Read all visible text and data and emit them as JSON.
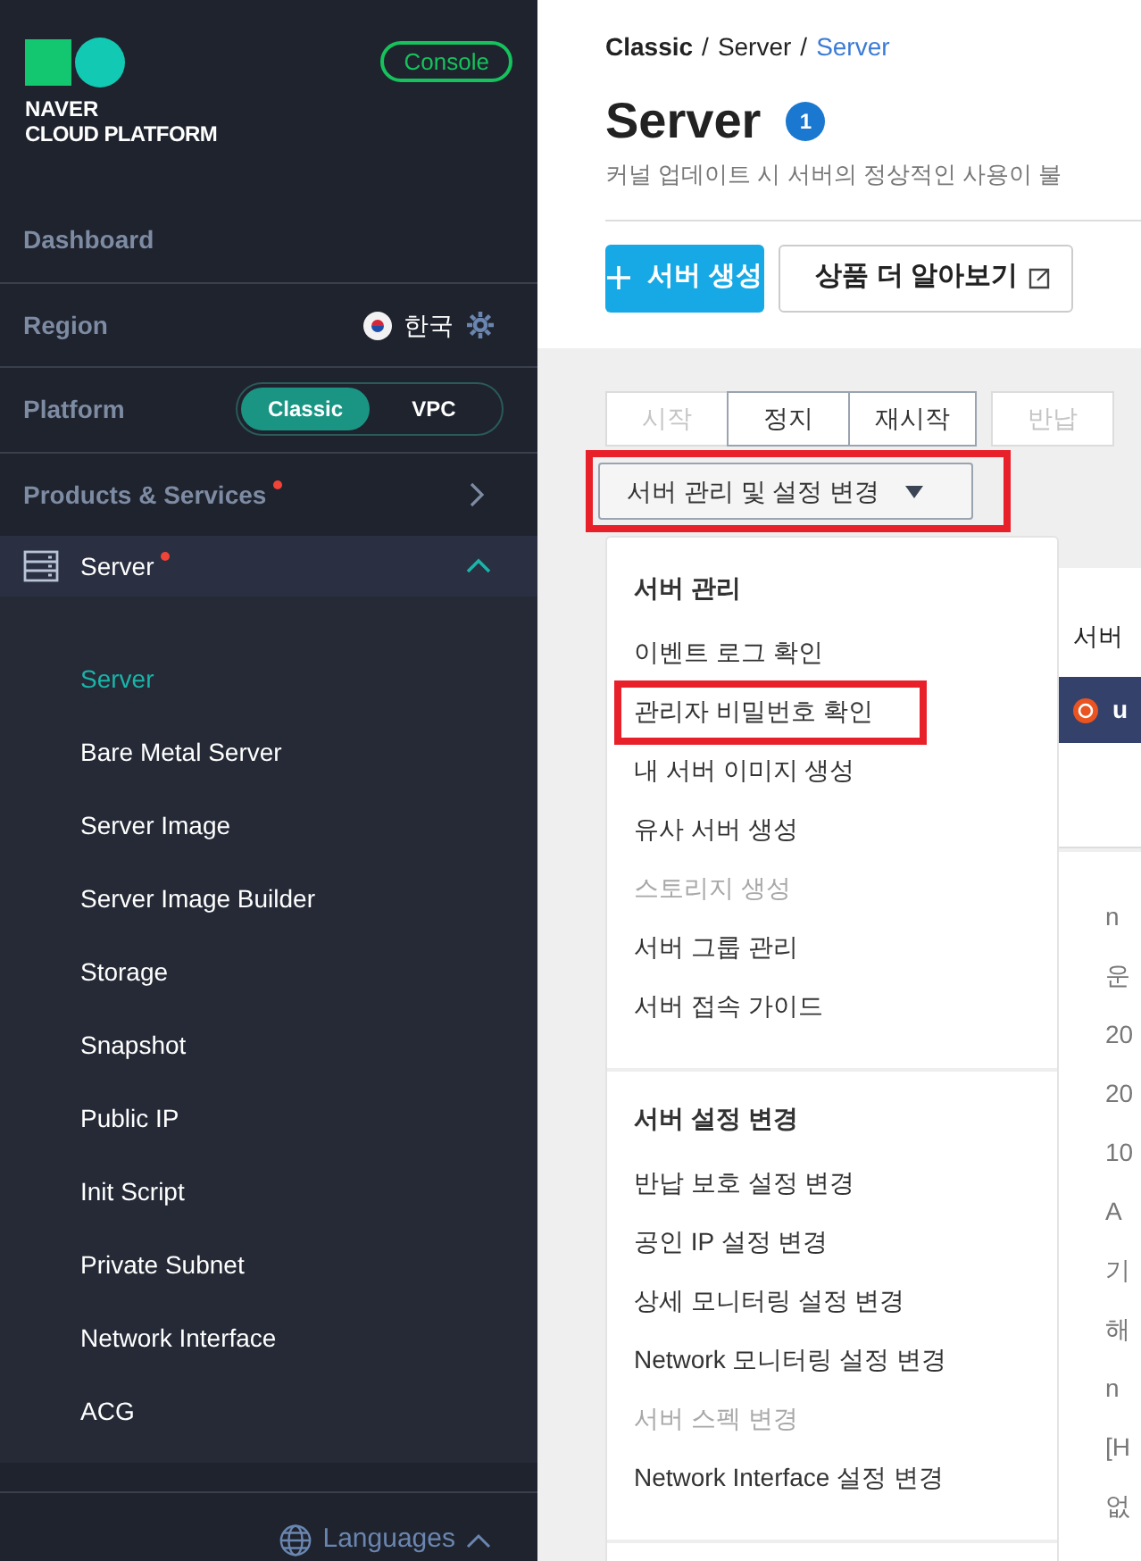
{
  "sidebar": {
    "brand": {
      "line1": "NAVER",
      "line2": "CLOUD PLATFORM"
    },
    "console_button": "Console",
    "dashboard": "Dashboard",
    "region": {
      "label": "Region",
      "value": "한국"
    },
    "platform": {
      "label": "Platform",
      "options": [
        {
          "label": "Classic",
          "selected": true
        },
        {
          "label": "VPC",
          "selected": false
        }
      ]
    },
    "products": {
      "label": "Products & Services",
      "new": true
    },
    "section": {
      "label": "Server",
      "new": true,
      "expanded": true,
      "items": [
        {
          "label": "Server",
          "selected": true
        },
        {
          "label": "Bare Metal Server",
          "selected": false
        },
        {
          "label": "Server Image",
          "selected": false
        },
        {
          "label": "Server Image Builder",
          "selected": false
        },
        {
          "label": "Storage",
          "selected": false
        },
        {
          "label": "Snapshot",
          "selected": false
        },
        {
          "label": "Public IP",
          "selected": false
        },
        {
          "label": "Init Script",
          "selected": false
        },
        {
          "label": "Private Subnet",
          "selected": false
        },
        {
          "label": "Network Interface",
          "selected": false
        },
        {
          "label": "ACG",
          "selected": false
        }
      ]
    },
    "languages": "Languages"
  },
  "breadcrumb": [
    "Classic",
    "Server",
    "Server"
  ],
  "breadcrumb_separator": "/",
  "title": "Server",
  "count": "1",
  "notice": "커널 업데이트 시 서버의 정상적인 사용이 불",
  "actions": {
    "create": "서버 생성",
    "learn_more": "상품 더 알아보기"
  },
  "server_buttons": [
    {
      "label": "시작",
      "disabled": true
    },
    {
      "label": "정지",
      "disabled": false
    },
    {
      "label": "재시작",
      "disabled": false
    },
    {
      "label": "반납",
      "disabled": true
    }
  ],
  "manage_dropdown": {
    "label": "서버 관리 및 설정 변경",
    "highlighted": true,
    "expanded": true
  },
  "menu": [
    {
      "title": "서버 관리",
      "items": [
        {
          "label": "이벤트 로그 확인",
          "disabled": false,
          "highlighted": false
        },
        {
          "label": "관리자 비밀번호 확인",
          "disabled": false,
          "highlighted": true
        },
        {
          "label": "내 서버 이미지 생성",
          "disabled": false,
          "highlighted": false
        },
        {
          "label": "유사 서버 생성",
          "disabled": false,
          "highlighted": false
        },
        {
          "label": "스토리지 생성",
          "disabled": true,
          "highlighted": false
        },
        {
          "label": "서버 그룹 관리",
          "disabled": false,
          "highlighted": false
        },
        {
          "label": "서버 접속 가이드",
          "disabled": false,
          "highlighted": false
        }
      ]
    },
    {
      "title": "서버 설정 변경",
      "items": [
        {
          "label": "반납 보호 설정 변경",
          "disabled": false,
          "highlighted": false
        },
        {
          "label": "공인 IP 설정 변경",
          "disabled": false,
          "highlighted": false
        },
        {
          "label": "상세 모니터링 설정 변경",
          "disabled": false,
          "highlighted": false
        },
        {
          "label": "Network 모니터링 설정 변경",
          "disabled": false,
          "highlighted": false
        },
        {
          "label": "서버 스펙 변경",
          "disabled": true,
          "highlighted": false
        },
        {
          "label": "Network Interface 설정 변경",
          "disabled": false,
          "highlighted": false
        }
      ]
    }
  ],
  "server_table": {
    "heading": "서버",
    "row": {
      "name": "u",
      "selected": true
    }
  },
  "details": [
    "n",
    "운",
    "20",
    "20",
    "10",
    "A",
    "기",
    "해",
    "n",
    "[H",
    "없"
  ]
}
